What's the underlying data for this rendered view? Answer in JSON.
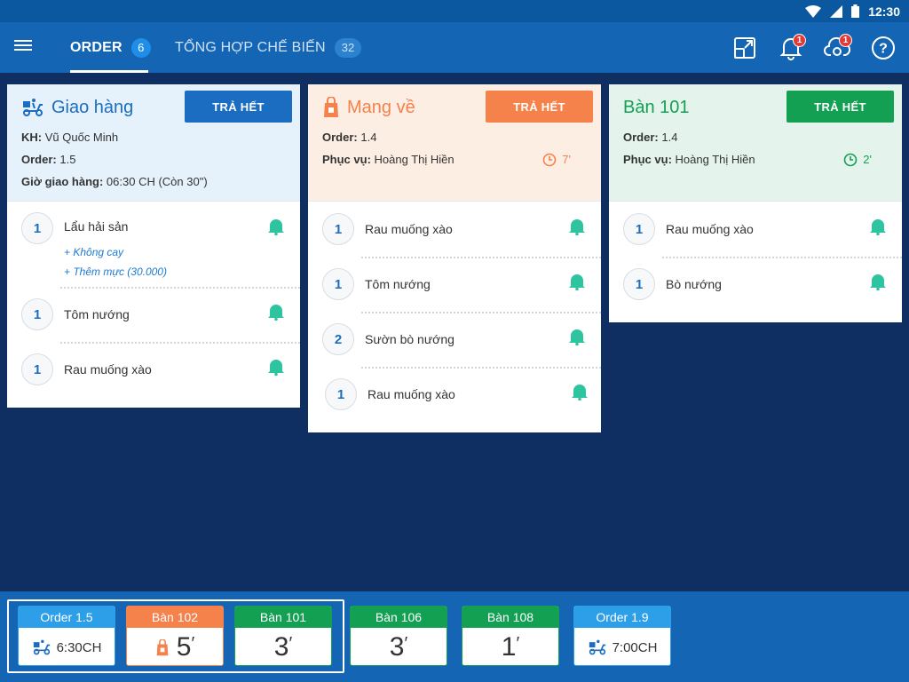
{
  "status_bar": {
    "time": "12:30"
  },
  "app_bar": {
    "tabs": [
      {
        "label": "ORDER",
        "count": "6",
        "active": true
      },
      {
        "label": "TỔNG HỢP CHẾ BIẾN",
        "count": "32",
        "active": false
      }
    ],
    "icons": [
      {
        "name": "expand-icon",
        "badge": ""
      },
      {
        "name": "bell-icon",
        "badge": "1"
      },
      {
        "name": "cloud-sync-icon",
        "badge": "1"
      },
      {
        "name": "help-icon",
        "badge": ""
      }
    ]
  },
  "colors": {
    "primary": "#1565b5",
    "delivery": "#1b6dc1",
    "takeaway": "#f5814b",
    "dinein": "#13a053",
    "bell": "#2ec4a0"
  },
  "cards": [
    {
      "type": "delivery",
      "title": "Giao hàng",
      "button": "TRẢ HẾT",
      "info": [
        {
          "label": "KH:",
          "value": "Vũ Quốc Minh"
        },
        {
          "label": "Order:",
          "value": "1.5"
        },
        {
          "label": "Giờ giao hàng:",
          "value": "06:30 CH (Còn 30\")"
        }
      ],
      "items": [
        {
          "qty": "1",
          "name": "Lẩu hải sản",
          "mods": [
            "+  Không cay",
            "+ Thêm mực (30.000)"
          ]
        },
        {
          "qty": "1",
          "name": "Tôm nướng"
        },
        {
          "qty": "1",
          "name": "Rau muống xào"
        }
      ]
    },
    {
      "type": "takeaway",
      "title": "Mang về",
      "button": "TRẢ HẾT",
      "info": [
        {
          "label": "Order:",
          "value": "1.4"
        },
        {
          "label": "Phục vụ:",
          "value": "Hoàng Thị Hiền"
        }
      ],
      "timer": "7'",
      "items": [
        {
          "qty": "1",
          "name": "Rau muống xào"
        },
        {
          "qty": "1",
          "name": "Tôm nướng"
        },
        {
          "qty": "2",
          "name": "Sườn bò nướng"
        },
        {
          "qty": "1",
          "name": "Rau muống xào"
        }
      ]
    },
    {
      "type": "dinein",
      "title": "Bàn 101",
      "button": "TRẢ HẾT",
      "info": [
        {
          "label": "Order:",
          "value": "1.4"
        },
        {
          "label": "Phục vụ:",
          "value": "Hoàng Thị Hiền"
        }
      ],
      "timer": "2'",
      "items": [
        {
          "qty": "1",
          "name": "Rau muống xào"
        },
        {
          "qty": "1",
          "name": "Bò nướng"
        }
      ]
    }
  ],
  "bottom_tiles": [
    {
      "header": "Order 1.5",
      "kind": "delivery",
      "value": "6:30CH"
    },
    {
      "header": "Bàn 102",
      "kind": "takeaway",
      "value": "5",
      "unit": "′"
    },
    {
      "header": "Bàn 101",
      "kind": "dinein",
      "value": "3",
      "unit": "′"
    },
    {
      "header": "Bàn 106",
      "kind": "dinein",
      "value": "3",
      "unit": "′"
    },
    {
      "header": "Bàn 108",
      "kind": "dinein",
      "value": "1",
      "unit": "′"
    },
    {
      "header": "Order 1.9",
      "kind": "delivery",
      "value": "7:00CH"
    }
  ]
}
